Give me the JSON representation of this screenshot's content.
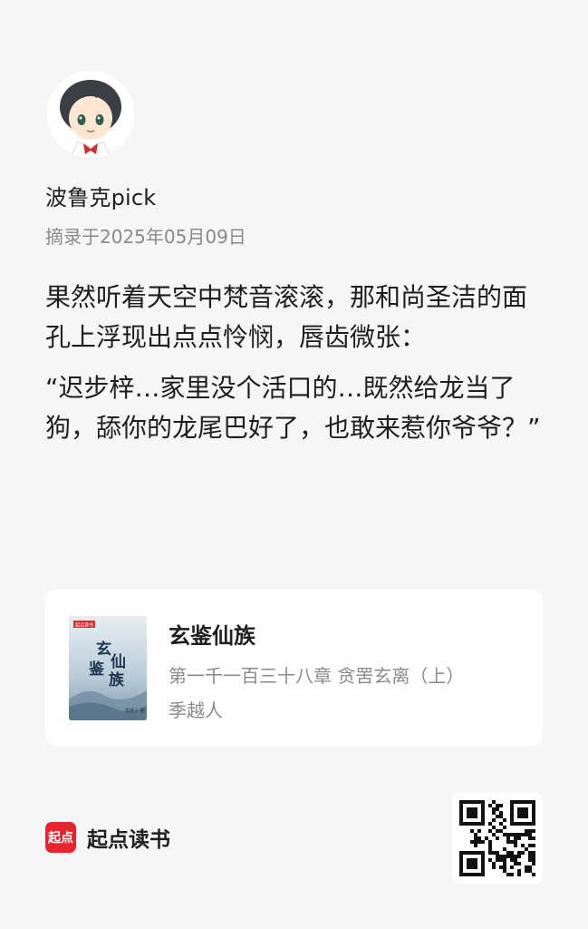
{
  "user": {
    "name": "波鲁克pick",
    "excerpt_date": "摘录于2025年05月09日"
  },
  "quote": {
    "paragraphs": [
      "果然听着天空中梵音滚滚，那和尚圣洁的面孔上浮现出点点怜悯，唇齿微张：",
      "“迟步梓…家里没个活口的…既然给龙当了狗，舔你的龙尾巴好了，也敢来惹你爷爷？”"
    ]
  },
  "book": {
    "title": "玄鉴仙族",
    "chapter": "第一千一百三十八章 贪罟玄离（上）",
    "author": "季越人",
    "cover": {
      "title_art": "玄鉴仙族",
      "badge": "起点读书",
      "author_mark": "季越人 著"
    }
  },
  "footer": {
    "logo_text": "起点",
    "brand_name": "起点读书"
  },
  "colors": {
    "background": "#f6f6f6",
    "card": "#ffffff",
    "brand_red": "#e8242f",
    "muted_text": "#8a8a8a"
  }
}
